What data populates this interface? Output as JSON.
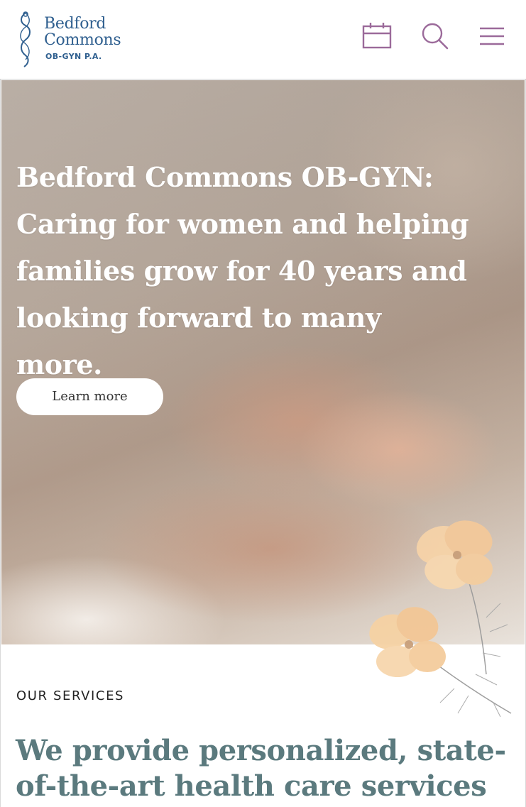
{
  "header": {
    "logo": {
      "name_line1": "Bedford",
      "name_line2": "Commons",
      "subtitle": "OB-GYN P.A."
    },
    "icons": [
      "calendar-icon",
      "search-icon",
      "menu-icon"
    ],
    "accent_color": "#9b6a9a"
  },
  "hero": {
    "headline": "Bedford Commons OB-GYN: Caring for women and helping families grow for 40 years and looking forward to many more.",
    "button_label": "Learn more"
  },
  "services": {
    "eyebrow": "OUR SERVICES",
    "heading": "We provide personalized, state-of-the-art health care services for"
  }
}
